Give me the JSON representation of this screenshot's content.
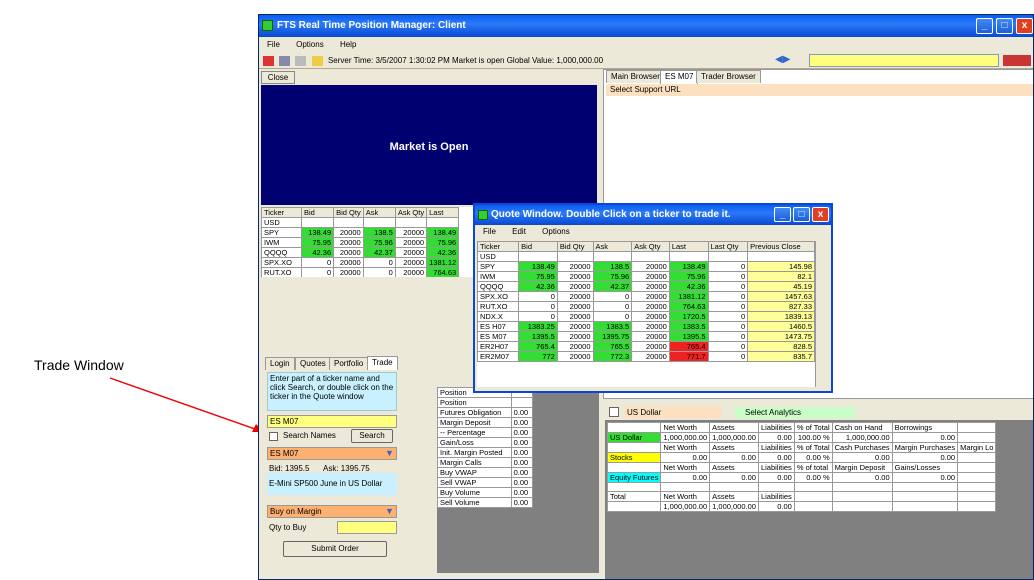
{
  "annotation": {
    "label": "Trade Window"
  },
  "window": {
    "title": "FTS Real Time Position Manager: Client"
  },
  "menu": [
    "File",
    "Options",
    "Help"
  ],
  "toolbar": {
    "status": "Server Time: 3/5/2007 1:30:02 PM  Market is open  Global Value: 1,000,000.00"
  },
  "market": {
    "close_label": "Close",
    "message": "Market is Open"
  },
  "grid_headers": [
    "Ticker",
    "Bid",
    "Bid Qty",
    "Ask",
    "Ask Qty",
    "Last"
  ],
  "main_rows": [
    {
      "t": "USD",
      "bid": "",
      "bq": "",
      "ask": "",
      "aq": "",
      "last": ""
    },
    {
      "t": "SPY",
      "bid": "138.49",
      "bq": "20000",
      "ask": "138.5",
      "aq": "20000",
      "last": "138.49"
    },
    {
      "t": "IWM",
      "bid": "75.95",
      "bq": "20000",
      "ask": "75.96",
      "aq": "20000",
      "last": "75.96"
    },
    {
      "t": "QQQQ",
      "bid": "42.36",
      "bq": "20000",
      "ask": "42.37",
      "aq": "20000",
      "last": "42.36"
    },
    {
      "t": "SPX.XO",
      "bid": "0",
      "bq": "20000",
      "ask": "0",
      "aq": "20000",
      "last": "1381.12"
    },
    {
      "t": "RUT.XO",
      "bid": "0",
      "bq": "20000",
      "ask": "0",
      "aq": "20000",
      "last": "764.63"
    },
    {
      "t": "NDX.X",
      "bid": "0",
      "bq": "20000",
      "ask": "0",
      "aq": "20000",
      "last": "1720.5"
    },
    {
      "t": "ES H07",
      "bid": "1383.25",
      "bq": "20000",
      "ask": "1383.5",
      "aq": "20000",
      "last": "1383.5"
    },
    {
      "t": "ES M07",
      "bid": "1395.5",
      "bq": "20000",
      "ask": "1395.75",
      "aq": "20000",
      "last": "1395.5"
    },
    {
      "t": "ER2H07",
      "bid": "765.4",
      "bq": "20000",
      "ask": "765.5",
      "aq": "20000",
      "last": "765.4"
    }
  ],
  "tabs_left": [
    "Login",
    "Quotes",
    "Portfolio",
    "Trade"
  ],
  "trade": {
    "help": "Enter part of a ticker name and click Search, or double click on the ticker in the Quote window",
    "ticker_input": "ES M07",
    "search_names": "Search Names",
    "search_btn": "Search",
    "selected": "ES M07",
    "bid": "Bid: 1395.5",
    "ask": "Ask: 1395.75",
    "description": "E-Mini SP500 June in US Dollar",
    "order_type": "Buy on Margin",
    "qty_label": "Qty to Buy",
    "qty_value": "",
    "submit": "Submit Order"
  },
  "positions": [
    {
      "k": "Position",
      "v": ""
    },
    {
      "k": "Position",
      "v": ""
    },
    {
      "k": "Futures Obligation",
      "v": "0.00"
    },
    {
      "k": "Margin Deposit",
      "v": "0.00"
    },
    {
      "k": "-- Percentage",
      "v": "0.00"
    },
    {
      "k": "Gain/Loss",
      "v": "0.00"
    },
    {
      "k": "Init. Margin Posted",
      "v": "0.00"
    },
    {
      "k": "Margin Calls",
      "v": "0.00"
    },
    {
      "k": "Buy VWAP",
      "v": "0.00"
    },
    {
      "k": "Sell VWAP",
      "v": "0.00"
    },
    {
      "k": "Buy Volume",
      "v": "0.00"
    },
    {
      "k": "Sell Volume",
      "v": "0.00"
    }
  ],
  "browser": {
    "tabs": [
      "Main Browser",
      "ES M07",
      "Trader Browser"
    ],
    "url_select": "Select Support URL"
  },
  "analytics": {
    "currency": "US Dollar",
    "select": "Select Analytics",
    "rows": [
      [
        "",
        "Net Worth",
        "Assets",
        "Liabilities",
        "% of Total",
        "Cash on Hand",
        "Borrowings",
        ""
      ],
      [
        "US Dollar",
        "1,000,000.00",
        "1,000,000.00",
        "0.00",
        "100.00 %",
        "1,000,000.00",
        "0.00",
        ""
      ],
      [
        "",
        "Net Worth",
        "Assets",
        "Liabilities",
        "% of Total",
        "Cash Purchases",
        "Margin Purchases",
        "Margin Lo"
      ],
      [
        "Stocks",
        "0.00",
        "0.00",
        "0.00",
        "0.00 %",
        "0.00",
        "0.00",
        ""
      ],
      [
        "",
        "Net Worth",
        "Assets",
        "Liabilities",
        "% of total",
        "Margin Deposit",
        "Gains/Losses",
        ""
      ],
      [
        "Equity Futures",
        "0.00",
        "0.00",
        "0.00",
        "0.00 %",
        "0.00",
        "0.00",
        ""
      ],
      [
        "",
        "",
        "",
        "",
        "",
        "",
        "",
        ""
      ],
      [
        "Total",
        "Net Worth",
        "Assets",
        "Liabilities",
        "",
        "",
        "",
        ""
      ],
      [
        "",
        "1,000,000.00",
        "1,000,000.00",
        "0.00",
        "",
        "",
        "",
        ""
      ]
    ]
  },
  "quote": {
    "title": "Quote Window.  Double Click on a ticker to trade it.",
    "menu": [
      "File",
      "Edit",
      "Options"
    ],
    "headers": [
      "Ticker",
      "Bid",
      "Bid Qty",
      "Ask",
      "Ask Qty",
      "Last",
      "Last Qty",
      "Previous Close"
    ],
    "rows": [
      [
        "USD",
        "",
        "",
        "",
        "",
        "",
        "",
        ""
      ],
      [
        "SPY",
        "138.49",
        "20000",
        "138.5",
        "20000",
        "138.49",
        "0",
        "145.98"
      ],
      [
        "IWM",
        "75.95",
        "20000",
        "75.96",
        "20000",
        "75.96",
        "0",
        "82.1"
      ],
      [
        "QQQQ",
        "42.36",
        "20000",
        "42.37",
        "20000",
        "42.36",
        "0",
        "45.19"
      ],
      [
        "SPX.XO",
        "0",
        "20000",
        "0",
        "20000",
        "1381.12",
        "0",
        "1457.63"
      ],
      [
        "RUT.XO",
        "0",
        "20000",
        "0",
        "20000",
        "764.63",
        "0",
        "827.33"
      ],
      [
        "NDX.X",
        "0",
        "20000",
        "0",
        "20000",
        "1720.5",
        "0",
        "1839.13"
      ],
      [
        "ES H07",
        "1383.25",
        "20000",
        "1383.5",
        "20000",
        "1383.5",
        "0",
        "1460.5"
      ],
      [
        "ES M07",
        "1395.5",
        "20000",
        "1395.75",
        "20000",
        "1395.5",
        "0",
        "1473.75"
      ],
      [
        "ER2H07",
        "765.4",
        "20000",
        "765.5",
        "20000",
        "765.4",
        "0",
        "828.5"
      ],
      [
        "ER2M07",
        "772",
        "20000",
        "772.3",
        "20000",
        "771.7",
        "0",
        "835.7"
      ]
    ]
  }
}
